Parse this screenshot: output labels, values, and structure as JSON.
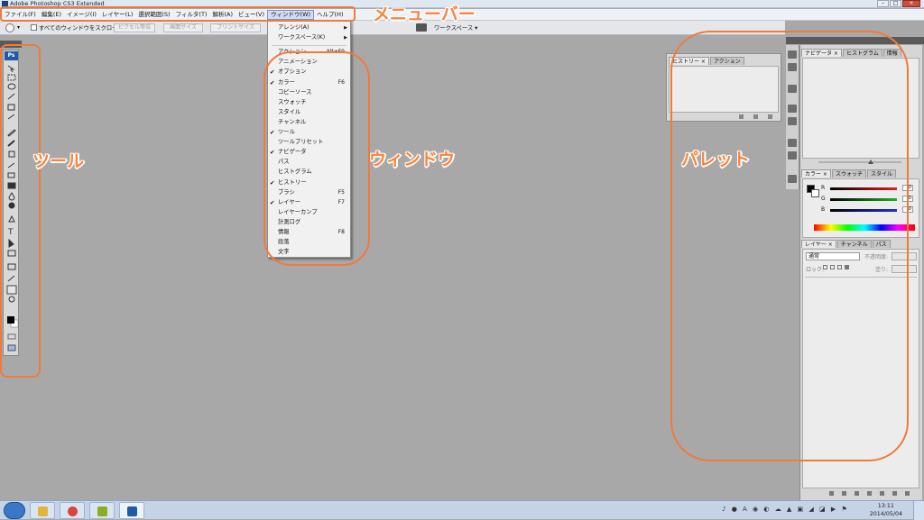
{
  "window": {
    "title": "Adobe Photoshop CS3 Extended"
  },
  "menubar": {
    "items": [
      {
        "label": "ファイル(F)"
      },
      {
        "label": "編集(E)"
      },
      {
        "label": "イメージ(I)"
      },
      {
        "label": "レイヤー(L)"
      },
      {
        "label": "選択範囲(S)"
      },
      {
        "label": "フィルタ(T)"
      },
      {
        "label": "解析(A)"
      },
      {
        "label": "ビュー(V)"
      },
      {
        "label": "ウィンドウ(W)"
      },
      {
        "label": "ヘルプ(H)"
      }
    ],
    "active_index": 8
  },
  "options_bar": {
    "scroll_all_label": "すべてのウィンドウをスクロール",
    "buttons": [
      "ピクセル等倍",
      "画面サイズ",
      "プリントサイズ"
    ],
    "workspace_label": "ワークスペース ▾"
  },
  "window_menu": {
    "items": [
      {
        "label": "アレンジ(A)",
        "submenu": true,
        "checked": false,
        "shortcut": ""
      },
      {
        "label": "ワークスペース(K)",
        "submenu": true,
        "checked": false,
        "shortcut": ""
      },
      {
        "label": "アクション",
        "submenu": false,
        "checked": false,
        "shortcut": "Alt+F9"
      },
      {
        "label": "アニメーション",
        "submenu": false,
        "checked": false,
        "shortcut": ""
      },
      {
        "label": "オプション",
        "submenu": false,
        "checked": true,
        "shortcut": ""
      },
      {
        "label": "カラー",
        "submenu": false,
        "checked": true,
        "shortcut": "F6"
      },
      {
        "label": "コピーソース",
        "submenu": false,
        "checked": false,
        "shortcut": ""
      },
      {
        "label": "スウォッチ",
        "submenu": false,
        "checked": false,
        "shortcut": ""
      },
      {
        "label": "スタイル",
        "submenu": false,
        "checked": false,
        "shortcut": ""
      },
      {
        "label": "チャンネル",
        "submenu": false,
        "checked": false,
        "shortcut": ""
      },
      {
        "label": "ツール",
        "submenu": false,
        "checked": true,
        "shortcut": ""
      },
      {
        "label": "ツールプリセット",
        "submenu": false,
        "checked": false,
        "shortcut": ""
      },
      {
        "label": "ナビゲータ",
        "submenu": false,
        "checked": true,
        "shortcut": ""
      },
      {
        "label": "パス",
        "submenu": false,
        "checked": false,
        "shortcut": ""
      },
      {
        "label": "ヒストグラム",
        "submenu": false,
        "checked": false,
        "shortcut": ""
      },
      {
        "label": "ヒストリー",
        "submenu": false,
        "checked": true,
        "shortcut": ""
      },
      {
        "label": "ブラシ",
        "submenu": false,
        "checked": false,
        "shortcut": "F5"
      },
      {
        "label": "レイヤー",
        "submenu": false,
        "checked": true,
        "shortcut": "F7"
      },
      {
        "label": "レイヤーカンプ",
        "submenu": false,
        "checked": false,
        "shortcut": ""
      },
      {
        "label": "計測ログ",
        "submenu": false,
        "checked": false,
        "shortcut": ""
      },
      {
        "label": "情報",
        "submenu": false,
        "checked": false,
        "shortcut": "F8"
      },
      {
        "label": "段落",
        "submenu": false,
        "checked": false,
        "shortcut": ""
      },
      {
        "label": "文字",
        "submenu": false,
        "checked": false,
        "shortcut": ""
      }
    ]
  },
  "history_panel": {
    "tabs": [
      "ヒストリー ×",
      "アクション"
    ]
  },
  "navigator_panel": {
    "tabs": [
      "ナビゲータ ×",
      "ヒストグラム",
      "情報"
    ]
  },
  "color_panel": {
    "tabs": [
      "カラー ×",
      "スウォッチ",
      "スタイル"
    ],
    "channels": [
      {
        "label": "R",
        "value": "0",
        "color": "#e02020"
      },
      {
        "label": "G",
        "value": "0",
        "color": "#20b020"
      },
      {
        "label": "B",
        "value": "0",
        "color": "#2030d0"
      }
    ]
  },
  "layers_panel": {
    "tabs": [
      "レイヤー ×",
      "チャンネル",
      "パス"
    ],
    "blend_mode": "通常",
    "opacity_label": "不透明度:",
    "lock_label": "ロック:",
    "fill_label": "塗り:"
  },
  "annotations": {
    "menubar": "メニューバー",
    "tools": "ツール",
    "window": "ウィンドウ",
    "palette": "パレット"
  },
  "taskbar": {
    "time": "13:11",
    "date": "2014/05/04"
  },
  "colors": {
    "accent_annotation": "#f07a3c",
    "canvas": "#a8a8a8",
    "ps_blue": "#1e5aa8"
  }
}
